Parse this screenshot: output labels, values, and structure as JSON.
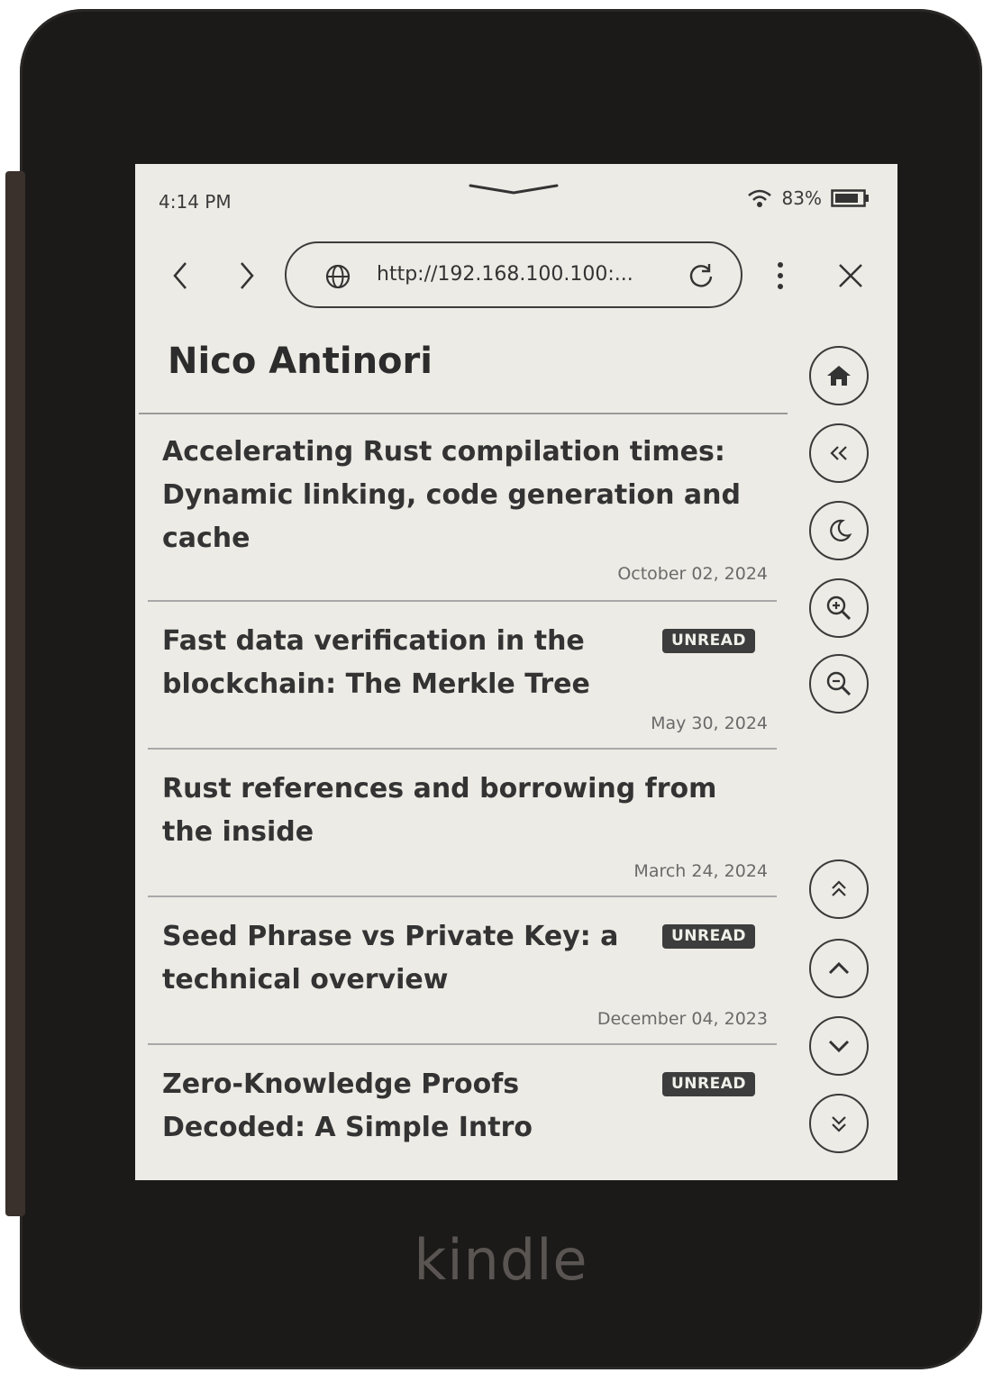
{
  "status": {
    "time": "4:14 PM",
    "battery": "83%"
  },
  "browser": {
    "url": "http://192.168.100.100:..."
  },
  "page": {
    "title": "Nico Antinori"
  },
  "posts": [
    {
      "title": "Accelerating Rust compilation times: Dynamic linking, code generation and cache",
      "date": "October 02, 2024",
      "badge": ""
    },
    {
      "title": "Fast data verification in the blockchain: The Merkle Tree",
      "date": "May 30, 2024",
      "badge": "UNREAD"
    },
    {
      "title": "Rust references and borrowing from the inside",
      "date": "March 24, 2024",
      "badge": ""
    },
    {
      "title": "Seed Phrase vs Private Key: a technical overview",
      "date": "December 04, 2023",
      "badge": "UNREAD"
    },
    {
      "title": "Zero-Knowledge Proofs Decoded: A Simple Intro",
      "date": "",
      "badge": "UNREAD"
    }
  ],
  "side_controls": [
    "home-icon",
    "back-double-icon",
    "moon-icon",
    "zoom-in-icon",
    "zoom-out-icon",
    "page-top-icon",
    "scroll-up-icon",
    "scroll-down-icon",
    "page-bottom-icon"
  ],
  "device": {
    "brand": "kindle"
  },
  "colors": {
    "screen": "#ecebe5",
    "bezel": "#1b1a19",
    "badge": "#3d3d3d"
  }
}
